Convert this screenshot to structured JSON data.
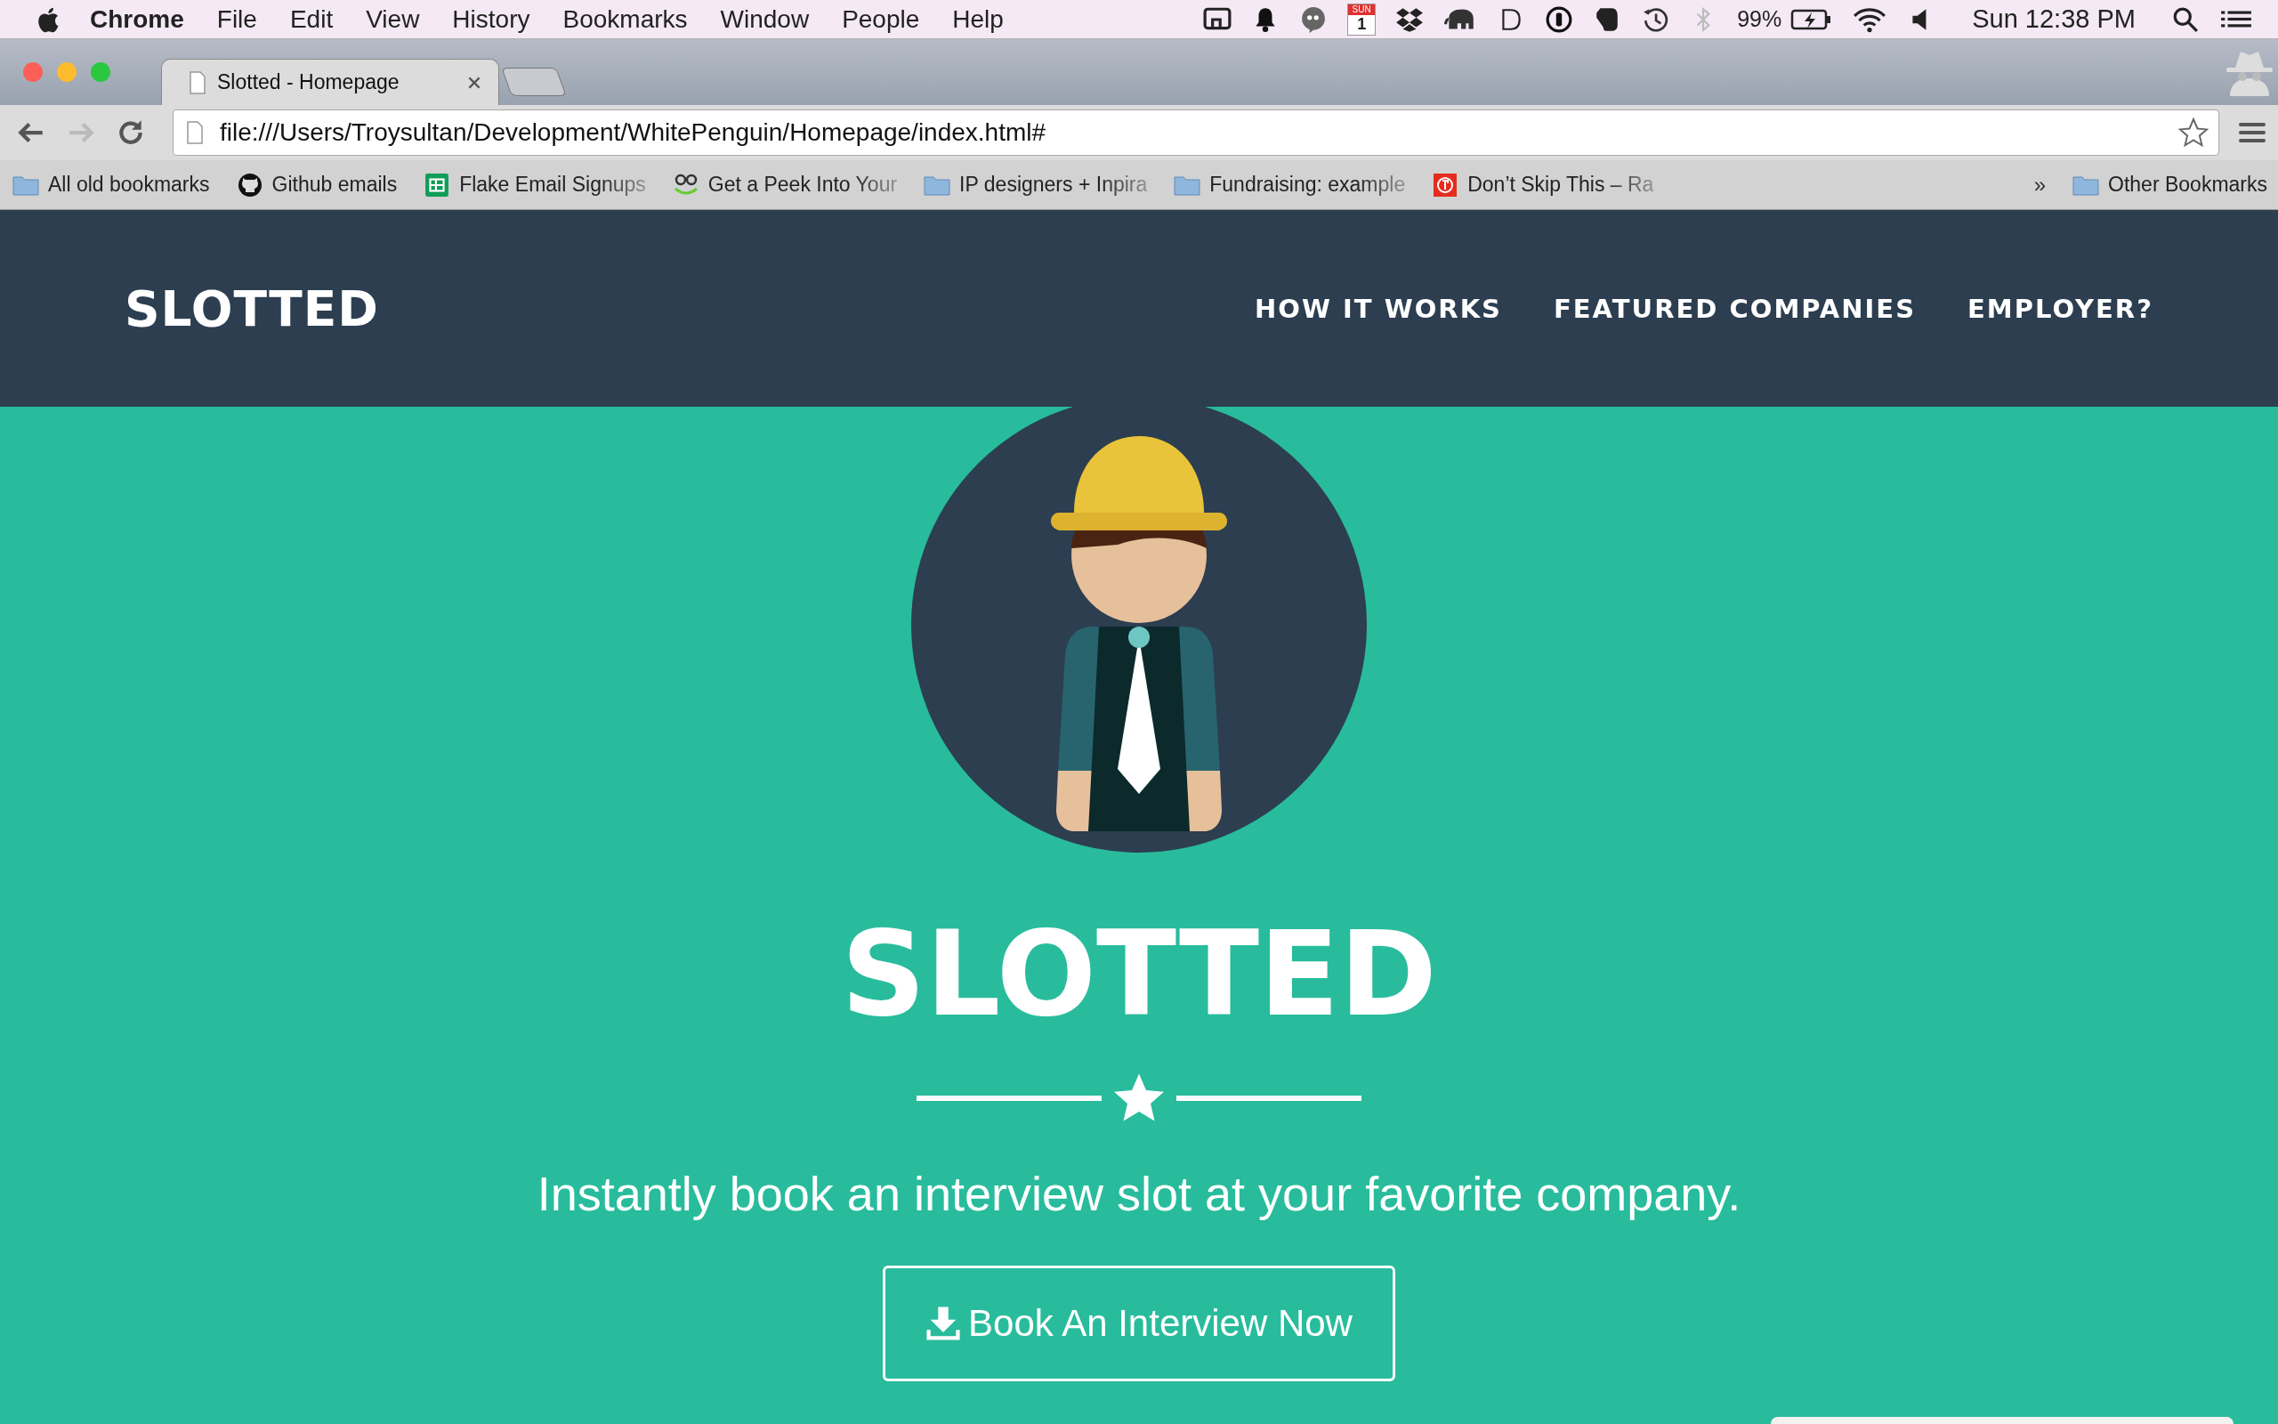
{
  "menu_bar": {
    "app_name": "Chrome",
    "items": [
      "File",
      "Edit",
      "View",
      "History",
      "Bookmarks",
      "Window",
      "People",
      "Help"
    ],
    "calendar_month": "SUN",
    "calendar_day": "1",
    "battery": "99%",
    "clock": "Sun 12:38 PM"
  },
  "tabs": [
    {
      "title": "Slotted - Homepage",
      "selected": true
    }
  ],
  "address_bar": {
    "value": "file:///Users/Troysultan/Development/WhitePenguin/Homepage/index.html#"
  },
  "bookmarks": [
    {
      "label": "All old bookmarks",
      "kind": "folder",
      "faded": false
    },
    {
      "label": "Github emails",
      "kind": "github",
      "faded": false
    },
    {
      "label": "Flake Email Signups",
      "kind": "sheet",
      "faded": true
    },
    {
      "label": "Get a Peek Into Your",
      "kind": "ee",
      "faded": true
    },
    {
      "label": "IP designers + Inpira",
      "kind": "folder",
      "faded": true
    },
    {
      "label": "Fundraising: example",
      "kind": "folder",
      "faded": true
    },
    {
      "label": "Don’t Skip This – Ra",
      "kind": "shield",
      "faded": true
    }
  ],
  "bookmarks_overflow": "»",
  "other_bookmarks": "Other Bookmarks",
  "site_nav": {
    "brand": "SLOTTED",
    "links": [
      "HOW IT WORKS",
      "FEATURED COMPANIES",
      "EMPLOYER?"
    ]
  },
  "hero": {
    "title": "SLOTTED",
    "tagline": "Instantly book an interview slot at your favorite company.",
    "button": "Book An Interview Now"
  }
}
